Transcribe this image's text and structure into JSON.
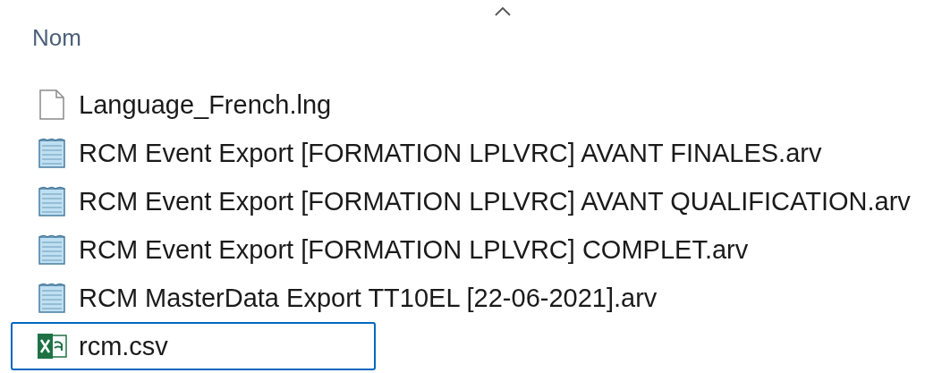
{
  "column_header": {
    "label": "Nom",
    "sorted_ascending": true
  },
  "files": [
    {
      "name": "Language_French.lng",
      "kind": "document",
      "selected": false
    },
    {
      "name": "RCM Event Export [FORMATION LPLVRC] AVANT FINALES.arv",
      "kind": "notepad",
      "selected": false
    },
    {
      "name": "RCM Event Export [FORMATION LPLVRC] AVANT QUALIFICATION.arv",
      "kind": "notepad",
      "selected": false
    },
    {
      "name": "RCM Event Export [FORMATION LPLVRC] COMPLET.arv",
      "kind": "notepad",
      "selected": false
    },
    {
      "name": "RCM MasterData Export TT10EL [22-06-2021].arv",
      "kind": "notepad",
      "selected": false
    },
    {
      "name": "rcm.csv",
      "kind": "spreadsheet",
      "selected": true
    }
  ]
}
